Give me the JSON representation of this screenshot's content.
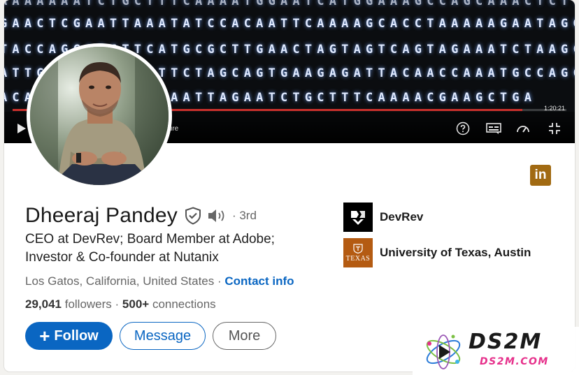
{
  "banner": {
    "dna_rows": [
      "AAAAAAATCTGCTTTCAAAATGGAATCATGGAAAGCCAGCAAACTCTTACTAG",
      "GAACTCGAATTAAATATCCACAATTCAAAAGCACCTAAAAAGAATAGGCTG",
      "TACCAGGATCTTCATGCGCTTGAACTAGTAGTCAGTAGAAATCTAAGCCCAG",
      "ATTGGCATGGTTGTTCTAGCAGTGAAGAGATTACAACCAAATGCCAGC",
      "ACATGCGGTACTCGAATTAGAATCTGCTTTCAAAACGAAGCTGA"
    ],
    "timecode": "1:20:21",
    "feature_text": "ture",
    "progress_fraction": 0.92
  },
  "profile": {
    "name": "Dheeraj Pandey",
    "degree": "· 3rd",
    "headline": "CEO at DevRev; Board Member at Adobe; Investor & Co-founder at Nutanix",
    "location": "Los Gatos, California, United States",
    "location_sep": " · ",
    "contact_label": "Contact info",
    "followers_count": "29,041",
    "followers_label": " followers",
    "connections_sep": "  · ",
    "connections_count": "500+",
    "connections_label": " connections"
  },
  "badge": {
    "label": "in"
  },
  "actions": {
    "follow_plus": "+",
    "follow_label": "Follow",
    "message_label": "Message",
    "more_label": "More"
  },
  "organizations": [
    {
      "name": "DevRev"
    },
    {
      "name": "University of Texas, Austin",
      "logo_text": "TEXAS"
    }
  ],
  "watermark": {
    "title": "DS2M",
    "subtitle": "DS2M.COM"
  },
  "colors": {
    "primary": "#0a66c2",
    "linkedin_badge": "#a16a12",
    "texas_orange": "#b45b12",
    "watermark_pink": "#e6308b"
  },
  "icons": [
    "play-icon",
    "help-icon",
    "captions-icon",
    "speed-icon",
    "exit-fullscreen-icon",
    "verified-shield-icon",
    "speaker-icon",
    "linkedin-icon"
  ]
}
